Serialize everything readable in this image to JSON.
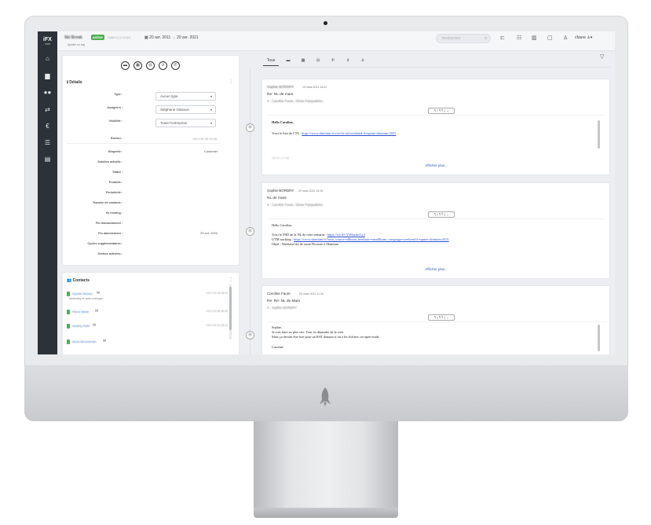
{
  "topbar": {
    "record_title": "Ski Break",
    "status_badge": "active",
    "created": "Créée il y a 14 ans",
    "add_tag": "Ajouter un tag",
    "date_start": "20 avr. 2011",
    "date_sep": "→",
    "date_end": "20 avr. 2021",
    "search_placeholder": "Rechercher",
    "username": "cfaure",
    "icons": [
      "inbox-icon",
      "list-icon",
      "grid-icon",
      "calendar-icon",
      "user-icon",
      "account-icon"
    ]
  },
  "sidebar": {
    "logo": "iFX",
    "logo_sub": "CRM",
    "items": [
      {
        "name": "dashboard-icon",
        "glyph": "⌂"
      },
      {
        "name": "building-icon",
        "glyph": "▆"
      },
      {
        "name": "people-icon",
        "glyph": "●"
      },
      {
        "name": "transfer-icon",
        "glyph": "⇄"
      },
      {
        "name": "euro-icon",
        "glyph": "€"
      },
      {
        "name": "list-icon",
        "glyph": "☰"
      },
      {
        "name": "contacts-icon",
        "glyph": "▤"
      }
    ]
  },
  "details": {
    "title": "Détails",
    "action_icons": [
      "chat-icon",
      "calendar-icon",
      "inbox-icon",
      "attachment-icon",
      "phone-icon"
    ],
    "fields": [
      {
        "label": "Type :",
        "value": "Aucun type",
        "kind": "select"
      },
      {
        "label": "Assigné à :",
        "value": "Stéphane Glasson",
        "kind": "select"
      },
      {
        "label": "Visibilité :",
        "value": "Toute l'entreprise",
        "kind": "select"
      },
      {
        "label": "Bureau :",
        "value": "+33 9 69 36 29 88",
        "kind": "blur"
      },
      {
        "label": "Etiquette :",
        "value": "Customer",
        "kind": "text"
      },
      {
        "label": "Solution actuelle :",
        "value": "",
        "kind": "text"
      },
      {
        "label": "Statut :",
        "value": "",
        "kind": "text"
      },
      {
        "label": "Produits :",
        "value": "",
        "kind": "text"
      },
      {
        "label": "Periodicite :",
        "value": "",
        "kind": "text"
      },
      {
        "label": "Tranche de contacts :",
        "value": "",
        "kind": "text"
      },
      {
        "label": "fix hosting :",
        "value": "",
        "kind": "text"
      },
      {
        "label": "Fin transactionnel :",
        "value": "",
        "kind": "text"
      },
      {
        "label": "Fin abonnement :",
        "value": "29 avr. 2020",
        "kind": "text"
      },
      {
        "label": "Cycles supplementaires :",
        "value": "",
        "kind": "text"
      },
      {
        "label": "Secteur activites :",
        "value": "",
        "kind": "text"
      }
    ]
  },
  "contacts": {
    "title": "Contacts",
    "rows": [
      {
        "name": "Sophie Bordry",
        "phone": "+33 6 09 18 48 02",
        "role": "Marketing et sales manager"
      },
      {
        "name": "Pierre Bédé",
        "phone": "+33 6 20 38 48 09",
        "role": ""
      },
      {
        "name": "Audrey Petit",
        "phone": "+33 6 50 02 28 12",
        "role": ""
      },
      {
        "name": "Anna Bouchonan",
        "phone": "",
        "role": ""
      }
    ]
  },
  "timeline": {
    "tabs": [
      "Tous",
      "chat-icon",
      "calendar-icon",
      "inbox-icon",
      "phone-icon",
      "attachment-icon",
      "user-icon"
    ],
    "tab_active": "Tous",
    "reply_label": "↰ | ↰↰ | →",
    "show_more": "Afficher plus..",
    "emails": [
      {
        "sender": "Sophie BORDRY",
        "sender_blurred": true,
        "date": "29 mars 2021 18:22",
        "subject": "Re: NL de mars",
        "to_prefix": "A :",
        "to": "Caroline Faure,  Gloria Pasqualetto,",
        "body": [
          "Hello Caroline,",
          "Voici le lien de CTA : ",
          "https://www.skimium.fr/vive-la-ski/weekend-d-equine-skimium-2021"
        ],
        "faint": "Ajouter un tag"
      },
      {
        "sender": "Sophie BORDRY",
        "sender_blurred": false,
        "date": "29 mars 2021 18:15",
        "subject": "NL de mars",
        "to_prefix": "A :",
        "to": "Caroline Faure,  Gloria Pasqualetto,",
        "body": [
          "Hello Caroline,",
          "Voici le PSD de la NL de cette semaine : ",
          "https://we.tl/t-VWhazkrCy3",
          "UTM tracking : ",
          "https://www.skimium.fr/?utm_source=nl&utm_medium=email&utm_campaign=weekend-d-equine-skimium-2021",
          "Objet : Weekend ski de ouste Dovaste à Skimium"
        ],
        "faint": ""
      },
      {
        "sender": "Caroline Faure",
        "sender_blurred": false,
        "date": "29 mars 2021 11:34",
        "subject": "Re: Re: NL de Mars",
        "to_prefix": "A :",
        "to": "Sophie BORDRY",
        "body": [
          "Sophie,",
          "Je vais faire au plus vite. Tout va dépendre de la créa.",
          "Mais ça devrait être bon pour un BAT demain si on a les fichiers cet après-midi.",
          "Caroline"
        ],
        "faint": ""
      }
    ]
  }
}
